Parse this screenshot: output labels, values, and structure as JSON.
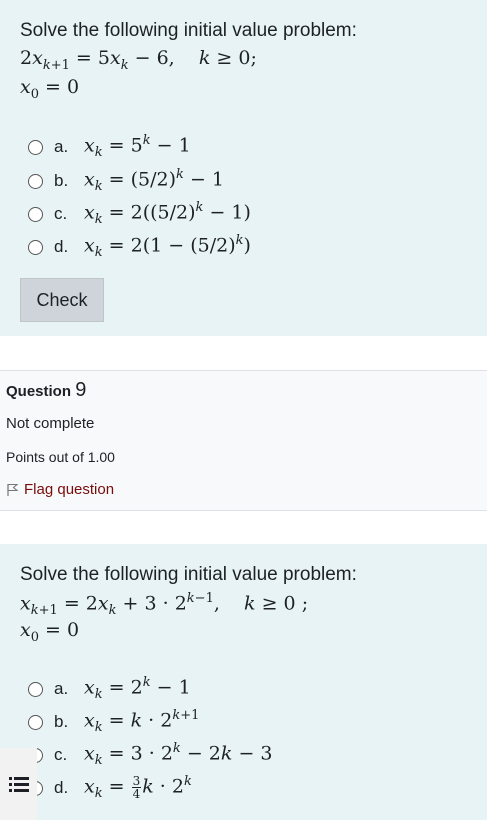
{
  "question1": {
    "prompt": "Solve the following initial value problem:",
    "check_label": "Check",
    "options": [
      {
        "letter": "a."
      },
      {
        "letter": "b."
      },
      {
        "letter": "c."
      },
      {
        "letter": "d."
      }
    ]
  },
  "question2_info": {
    "label": "Question",
    "number": "9",
    "state": "Not complete",
    "grade": "Points out of 1.00",
    "flag_label": "Flag question"
  },
  "question2": {
    "prompt": "Solve the following initial value problem:",
    "options": [
      {
        "letter": "a."
      },
      {
        "letter": "b."
      },
      {
        "letter": "c."
      },
      {
        "letter": "d."
      }
    ]
  },
  "icons": {
    "flag": "flag-icon",
    "radio": "radio-icon",
    "drawer": "list-icon"
  },
  "colors": {
    "content_bg": "#e7f3f5",
    "button_bg": "#ced4da",
    "flag_text": "#7a0c0c"
  }
}
